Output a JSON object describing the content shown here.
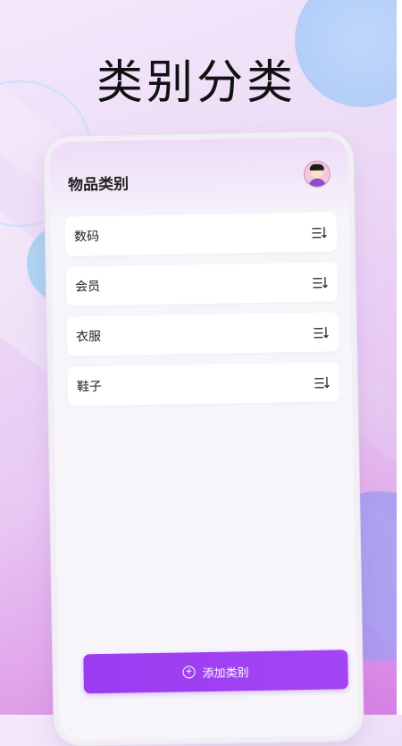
{
  "hero": {
    "title": "类别分类"
  },
  "phone": {
    "header_title": "物品类别",
    "categories": [
      {
        "label": "数码"
      },
      {
        "label": "会员"
      },
      {
        "label": "衣服"
      },
      {
        "label": "鞋子"
      }
    ],
    "add_button_label": "添加类别"
  },
  "colors": {
    "accent": "#9a3cf0",
    "background_top": "#f3e8fb",
    "background_bottom": "#d680e6"
  },
  "icons": {
    "avatar": "user-avatar-icon",
    "drag": "drag-handle-icon",
    "add": "plus-circle-icon"
  }
}
